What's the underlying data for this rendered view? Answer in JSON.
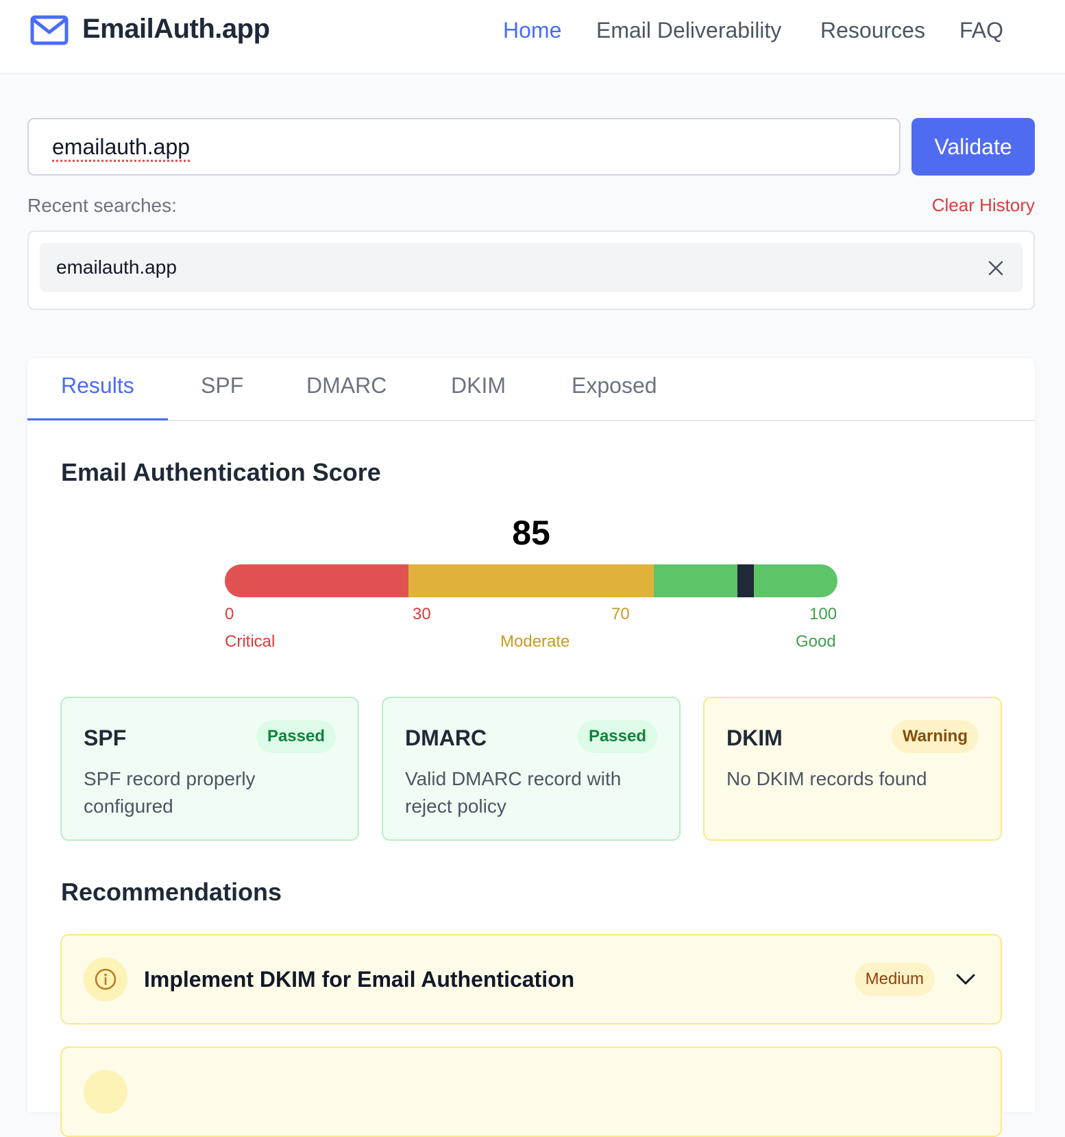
{
  "header": {
    "brand": "EmailAuth.app",
    "nav": [
      "Home",
      "Email Deliverability",
      "Resources",
      "FAQ"
    ],
    "active_nav": "Home"
  },
  "search": {
    "value": "emailauth.app",
    "validate_label": "Validate",
    "recent_label": "Recent searches:",
    "clear_label": "Clear History",
    "recent_items": [
      "emailauth.app"
    ]
  },
  "tabs": {
    "items": [
      "Results",
      "SPF",
      "DMARC",
      "DKIM",
      "Exposed"
    ],
    "active": "Results"
  },
  "score": {
    "title": "Email Authentication Score",
    "value": "85",
    "fraction": 0.85,
    "ticks": [
      "0",
      "30",
      "70",
      "100"
    ],
    "ranges": [
      "Critical",
      "Moderate",
      "Good"
    ],
    "colors": {
      "critical": "#e05252",
      "moderate": "#e0b23a",
      "good": "#5dc468"
    }
  },
  "checks": [
    {
      "title": "SPF",
      "badge": "Passed",
      "desc": "SPF record properly configured",
      "status": "passed"
    },
    {
      "title": "DMARC",
      "badge": "Passed",
      "desc": "Valid DMARC record with reject policy",
      "status": "passed"
    },
    {
      "title": "DKIM",
      "badge": "Warning",
      "desc": "No DKIM records found",
      "status": "warning"
    }
  ],
  "recommendations": {
    "title": "Recommendations",
    "items": [
      {
        "text": "Implement DKIM for Email Authentication",
        "priority": "Medium",
        "icon": "info-icon"
      },
      {
        "text": "",
        "priority": "",
        "icon": "info-icon"
      }
    ]
  }
}
